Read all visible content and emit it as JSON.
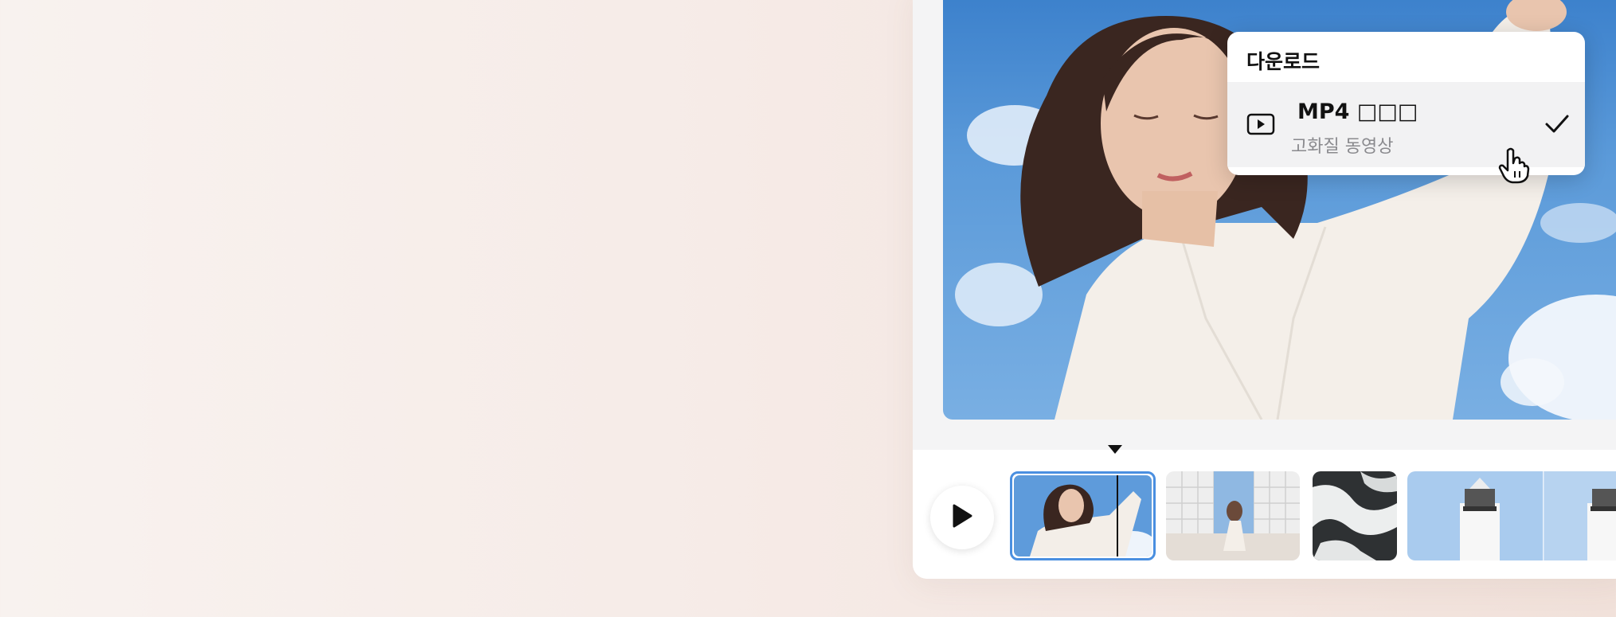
{
  "download_menu": {
    "title": "다운로드",
    "option": {
      "label": "MP4 □□□",
      "sublabel": "고화질 동영상",
      "icon": "video-play-icon",
      "selected": true
    }
  },
  "player": {
    "play_icon": "play-icon"
  },
  "colors": {
    "selected_clip_border": "#4a8fe0",
    "menu_bg": "#ffffff",
    "option_highlight": "#f2f2f3"
  }
}
